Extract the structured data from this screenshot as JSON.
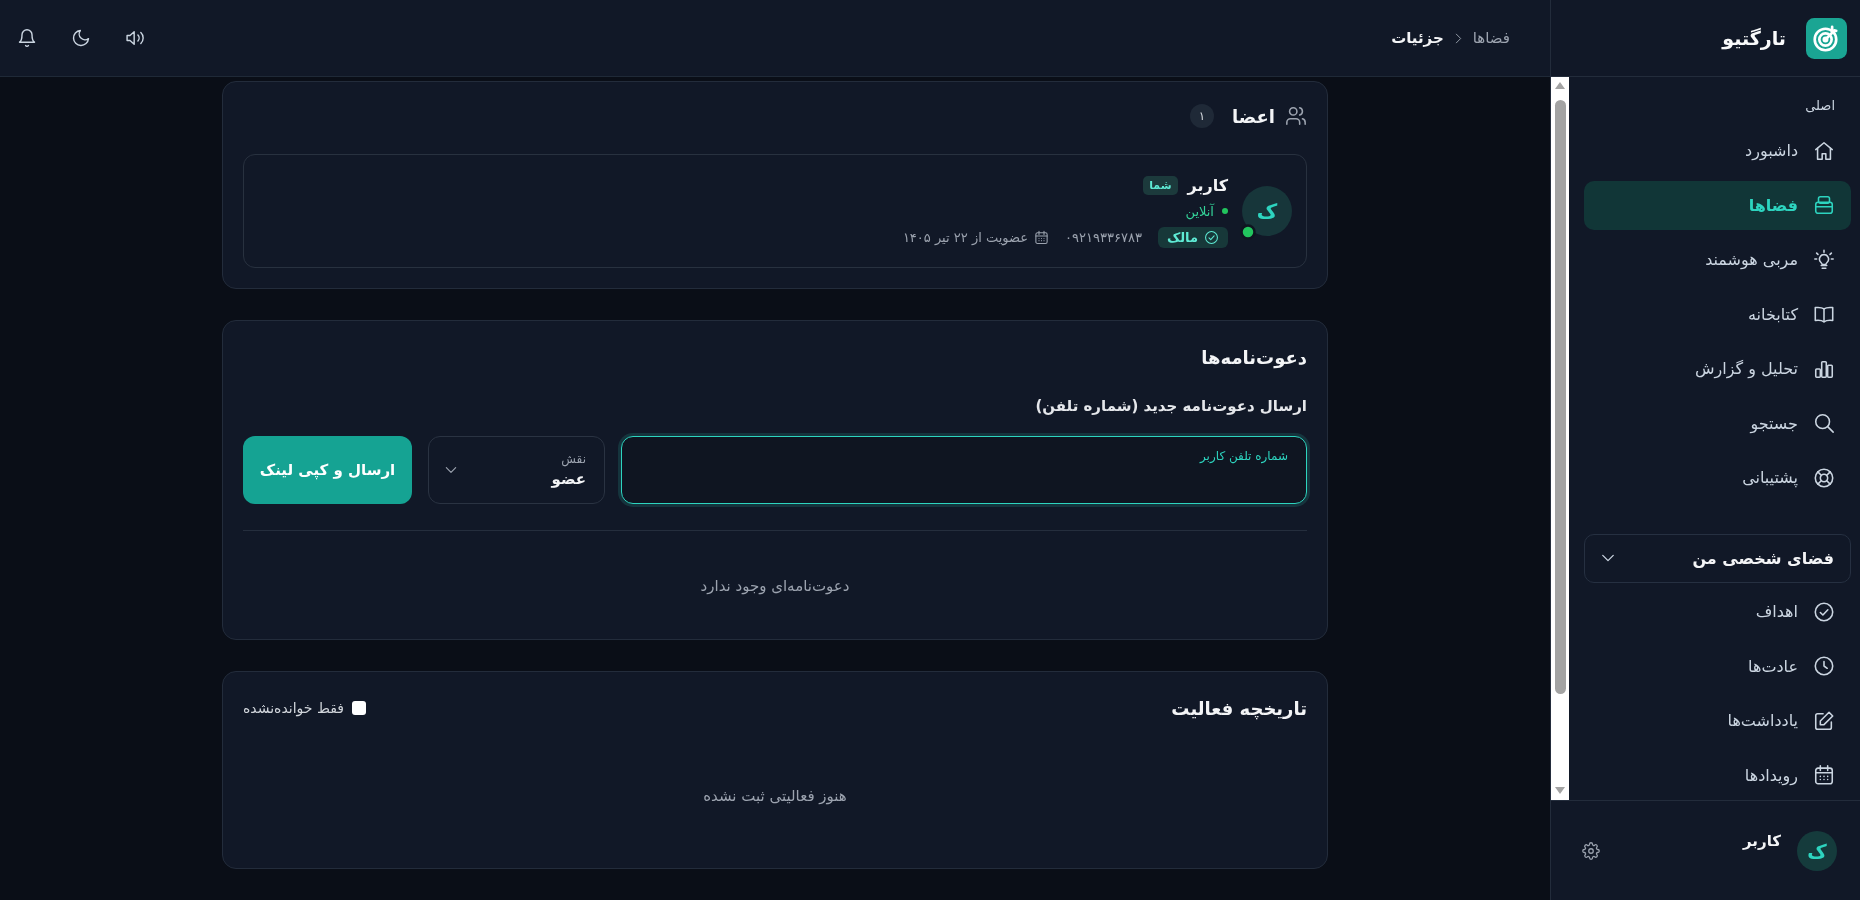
{
  "sidebar": {
    "brand": "تارگتیو",
    "section_label": "اصلی",
    "items": [
      {
        "label": "داشبورد",
        "selected": false
      },
      {
        "label": "فضاها",
        "selected": true
      },
      {
        "label": "مربی هوشمند",
        "selected": false
      },
      {
        "label": "کتابخانه",
        "selected": false
      },
      {
        "label": "تحلیل و گزارش",
        "selected": false
      },
      {
        "label": "جستجو",
        "selected": false
      },
      {
        "label": "پشتیبانی",
        "selected": false
      }
    ],
    "group": {
      "label": "فضای شخصی من",
      "expanded": true,
      "items": [
        {
          "label": "اهداف",
          "selected": false
        },
        {
          "label": "عادت‌ها",
          "selected": false
        },
        {
          "label": "یادداشت‌ها",
          "selected": false
        },
        {
          "label": "رویدادها",
          "selected": false
        }
      ]
    },
    "user": {
      "initial": "ک",
      "name": "کاربر"
    }
  },
  "header": {
    "breadcrumb": [
      "فضاها",
      "جزئیات"
    ]
  },
  "members": {
    "title": "اعضا",
    "count": "۱",
    "list": [
      {
        "initial": "ک",
        "name": "کاربر",
        "you_badge": "شما",
        "online": true,
        "status": "آنلاین",
        "role": "مالک",
        "phone": "۰۹۲۱۹۳۳۶۷۸۳",
        "joined": "عضویت از ۲۲ تیر ۱۴۰۵"
      }
    ]
  },
  "invitations": {
    "title": "دعوت‌نامه‌ها",
    "form_title": "ارسال دعوت‌نامه جدید (شماره تلفن)",
    "phone_field": {
      "label": "شماره تلفن کاربر",
      "focused": true
    },
    "role_select": {
      "label": "نقش",
      "value": "عضو"
    },
    "submit_button": "ارسال و کپی لینک",
    "empty": "دعوت‌نامه‌ای وجود ندارد"
  },
  "activity": {
    "title": "تاریخچه فعالیت",
    "unread_filter": {
      "label": "فقط خوانده‌نشده",
      "checked": false
    },
    "empty": "هنوز فعالیتی ثبت نشده"
  }
}
